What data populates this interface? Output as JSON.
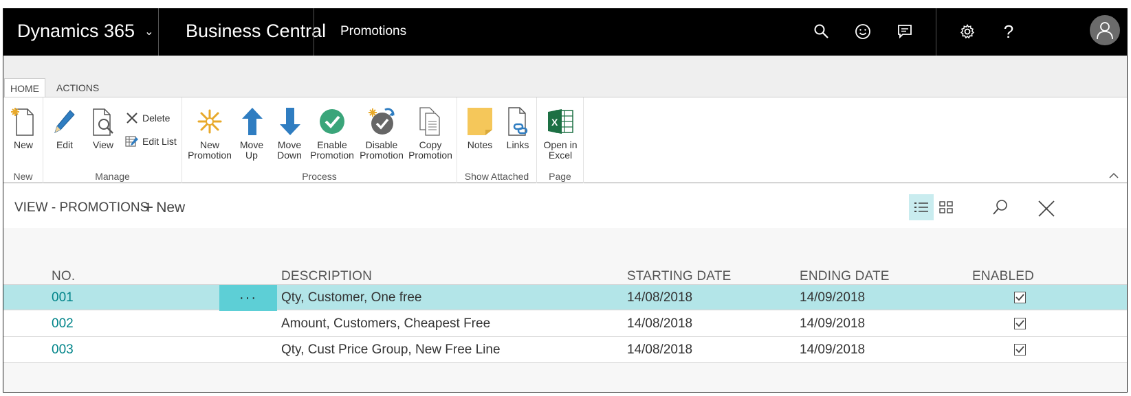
{
  "topbar": {
    "product": "Dynamics 365",
    "app": "Business Central",
    "page": "Promotions",
    "icons": [
      "search-icon",
      "smiley-icon",
      "chat-icon",
      "settings-icon",
      "help-icon",
      "user-avatar-icon"
    ],
    "help_glyph": "?"
  },
  "ribbon": {
    "tabs": [
      "HOME",
      "ACTIONS"
    ],
    "active_tab": "HOME",
    "groups": {
      "new": {
        "label": "New",
        "new": "New"
      },
      "manage": {
        "label": "Manage",
        "edit": "Edit",
        "view": "View",
        "delete": "Delete",
        "edit_list": "Edit List"
      },
      "process": {
        "label": "Process",
        "new_promotion": [
          "New",
          "Promotion"
        ],
        "move_up": [
          "Move",
          "Up"
        ],
        "move_down": [
          "Move",
          "Down"
        ],
        "enable_promotion": [
          "Enable",
          "Promotion"
        ],
        "disable_promotion": [
          "Disable",
          "Promotion"
        ],
        "copy_promotion": [
          "Copy",
          "Promotion"
        ]
      },
      "show_attached": {
        "label": "Show Attached",
        "notes": "Notes",
        "links": "Links"
      },
      "page": {
        "label": "Page",
        "open_in_excel": [
          "Open in",
          "Excel"
        ]
      }
    },
    "excel_glyph": "X"
  },
  "view": {
    "title": "VIEW - PROMOTIONS",
    "new_label": "New"
  },
  "list": {
    "columns": {
      "no": "NO.",
      "description": "DESCRIPTION",
      "starting_date": "STARTING DATE",
      "ending_date": "ENDING DATE",
      "enabled": "ENABLED"
    },
    "rows": [
      {
        "no": "001",
        "description": "Qty, Customer, One free",
        "starting_date": "14/08/2018",
        "ending_date": "14/09/2018",
        "enabled": true,
        "selected": true
      },
      {
        "no": "002",
        "description": "Amount, Customers, Cheapest Free",
        "starting_date": "14/08/2018",
        "ending_date": "14/09/2018",
        "enabled": true,
        "selected": false
      },
      {
        "no": "003",
        "description": "Qty, Cust Price Group, New Free Line",
        "starting_date": "14/08/2018",
        "ending_date": "14/09/2018",
        "enabled": true,
        "selected": false
      }
    ],
    "row_menu_glyph": "···"
  },
  "colors": {
    "accent": "#008489",
    "selected_row": "#b3e5e8",
    "row_menu": "#5dcfd6",
    "topbar": "#000000"
  }
}
